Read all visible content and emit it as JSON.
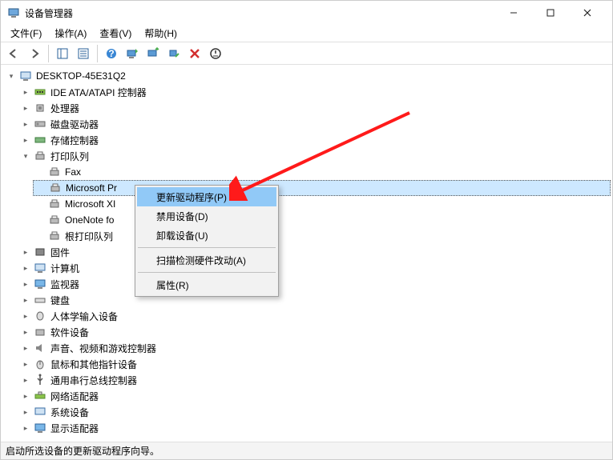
{
  "window": {
    "title": "设备管理器"
  },
  "menubar": {
    "file": "文件(F)",
    "action": "操作(A)",
    "view": "查看(V)",
    "help": "帮助(H)"
  },
  "tree": {
    "root": "DESKTOP-45E31Q2",
    "ide": "IDE ATA/ATAPI 控制器",
    "cpu": "处理器",
    "disk": "磁盘驱动器",
    "storage": "存储控制器",
    "printqueue": "打印队列",
    "printers": {
      "fax": "Fax",
      "msPrint": "Microsoft Pr",
      "msXps": "Microsoft XI",
      "onenote": "OneNote fo",
      "root": "根打印队列"
    },
    "firmware": "固件",
    "computer": "计算机",
    "monitor": "监视器",
    "keyboard": "键盘",
    "hid": "人体学输入设备",
    "software": "软件设备",
    "audio": "声音、视频和游戏控制器",
    "mouse": "鼠标和其他指针设备",
    "usb": "通用串行总线控制器",
    "network": "网络适配器",
    "system": "系统设备",
    "display": "显示适配器"
  },
  "context_menu": {
    "update_driver": "更新驱动程序(P)",
    "disable": "禁用设备(D)",
    "uninstall": "卸载设备(U)",
    "scan_hardware": "扫描检测硬件改动(A)",
    "properties": "属性(R)"
  },
  "statusbar": {
    "text": "启动所选设备的更新驱动程序向导。"
  }
}
